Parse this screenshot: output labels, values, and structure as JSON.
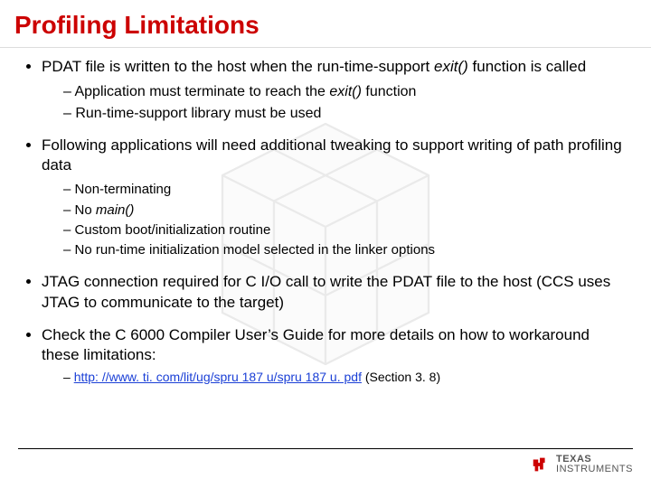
{
  "title": "Profiling Limitations",
  "b1": {
    "pre": "PDAT file is written to the host when the run-time-support ",
    "em": "exit()",
    "post": " function is called",
    "s1_pre": "Application must terminate to reach the ",
    "s1_em": "exit()",
    "s1_post": " function",
    "s2": "Run-time-support library must be used"
  },
  "b2": {
    "text": "Following applications will need additional tweaking to support writing of path profiling data",
    "s1": "Non-terminating",
    "s2_pre": "No ",
    "s2_em": "main()",
    "s3": "Custom boot/initialization routine",
    "s4": "No run-time initialization model selected in the linker options"
  },
  "b3": "JTAG connection required for C I/O call to write the PDAT file to the host (CCS uses JTAG to communicate to the target)",
  "b4": {
    "text": "Check the C 6000 Compiler User’s Guide for more details on how to workaround these limitations:",
    "link": "http: //www. ti. com/lit/ug/spru 187 u/spru 187 u. pdf",
    "link_post": " (Section 3. 8)"
  },
  "footer": {
    "brand1": "TEXAS",
    "brand2": "INSTRUMENTS"
  }
}
